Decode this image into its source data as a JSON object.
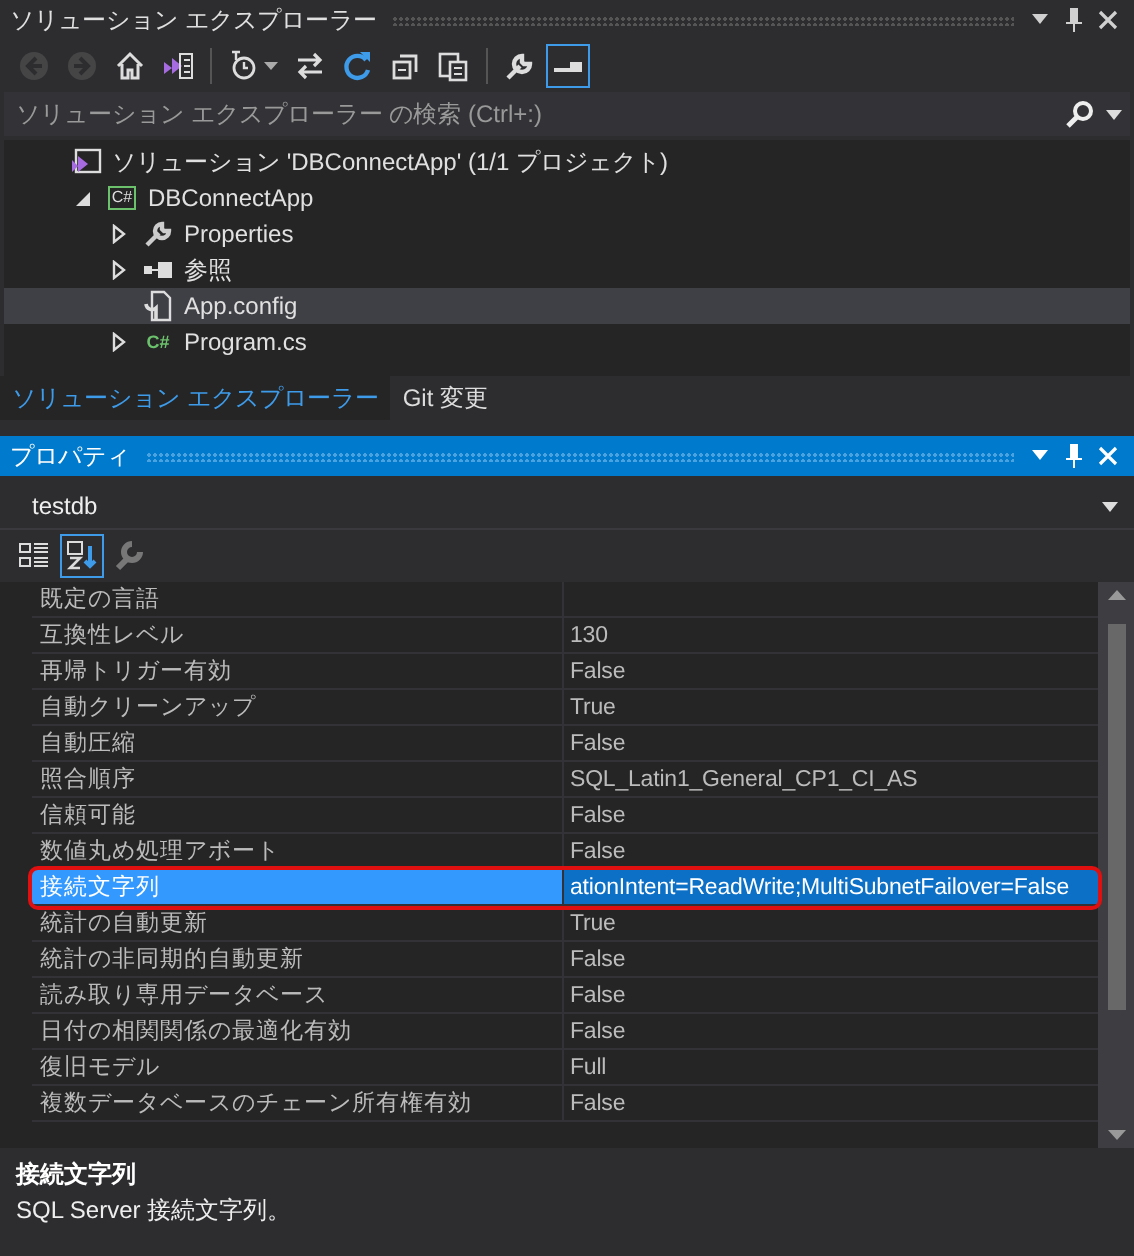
{
  "solution_explorer": {
    "title": "ソリューション エクスプローラー",
    "toolbar": [
      {
        "kind": "back",
        "disabled": true
      },
      {
        "kind": "forward",
        "disabled": true
      },
      {
        "kind": "home",
        "disabled": false
      },
      {
        "kind": "switch-views",
        "disabled": false
      },
      {
        "kind": "history",
        "disabled": false
      },
      {
        "kind": "sync",
        "disabled": false
      },
      {
        "kind": "refresh",
        "disabled": false
      },
      {
        "kind": "collapse",
        "disabled": false
      },
      {
        "kind": "show-all",
        "disabled": false
      },
      {
        "kind": "properties",
        "disabled": false,
        "selected": false
      },
      {
        "kind": "preview",
        "disabled": false,
        "selected": true
      }
    ],
    "search": {
      "placeholder": "ソリューション エクスプローラー の検索 (Ctrl+:)"
    },
    "tree": [
      {
        "kind": "solution",
        "label": "ソリューション 'DBConnectApp' (1/1 プロジェクト)",
        "selected": false,
        "children": [
          {
            "kind": "project",
            "badge": "C#",
            "label": "DBConnectApp",
            "selected": false,
            "expanded": true,
            "children": [
              {
                "kind": "properties",
                "label": "Properties",
                "selected": false,
                "expanded": false
              },
              {
                "kind": "references",
                "label": "参照",
                "selected": false,
                "expanded": false
              },
              {
                "kind": "config",
                "label": "App.config",
                "selected": true
              },
              {
                "kind": "csharp",
                "badge": "C#",
                "label": "Program.cs",
                "selected": false,
                "expanded": false
              }
            ]
          }
        ]
      }
    ],
    "tabs": [
      {
        "label": "ソリューション エクスプローラー",
        "selected": true
      },
      {
        "label": "Git 変更",
        "selected": false
      }
    ]
  },
  "properties": {
    "title": "プロパティ",
    "object": "testdb",
    "toolbar": [
      {
        "kind": "categorized",
        "selected": false
      },
      {
        "kind": "alphabetical",
        "selected": true
      },
      {
        "kind": "property-pages",
        "selected": false
      }
    ],
    "rows": [
      {
        "name": "既定の言語",
        "selected": false
      },
      {
        "name": "互換性レベル",
        "value": "130",
        "selected": false
      },
      {
        "name": "再帰トリガー有効",
        "value": "False",
        "selected": false
      },
      {
        "name": "自動クリーンアップ",
        "value": "True",
        "selected": false
      },
      {
        "name": "自動圧縮",
        "value": "False",
        "selected": false
      },
      {
        "name": "照合順序",
        "value": "SQL_Latin1_General_CP1_CI_AS",
        "selected": false
      },
      {
        "name": "信頼可能",
        "value": "False",
        "selected": false
      },
      {
        "name": "数値丸め処理アボート",
        "value": "False",
        "selected": false
      },
      {
        "name": "接続文字列",
        "value": "ationIntent=ReadWrite;MultiSubnetFailover=False",
        "selected": true,
        "highlighted": true
      },
      {
        "name": "統計の自動更新",
        "value": "True",
        "selected": false
      },
      {
        "name": "統計の非同期的自動更新",
        "value": "False",
        "selected": false
      },
      {
        "name": "読み取り専用データベース",
        "value": "False",
        "selected": false
      },
      {
        "name": "日付の相関関係の最適化有効",
        "value": "False",
        "selected": false
      },
      {
        "name": "復旧モデル",
        "value": "Full",
        "selected": false
      },
      {
        "name": "複数データベースのチェーン所有権有効",
        "value": "False",
        "selected": false
      }
    ],
    "description": {
      "title": "接続文字列",
      "text": "SQL Server 接続文字列。"
    }
  }
}
